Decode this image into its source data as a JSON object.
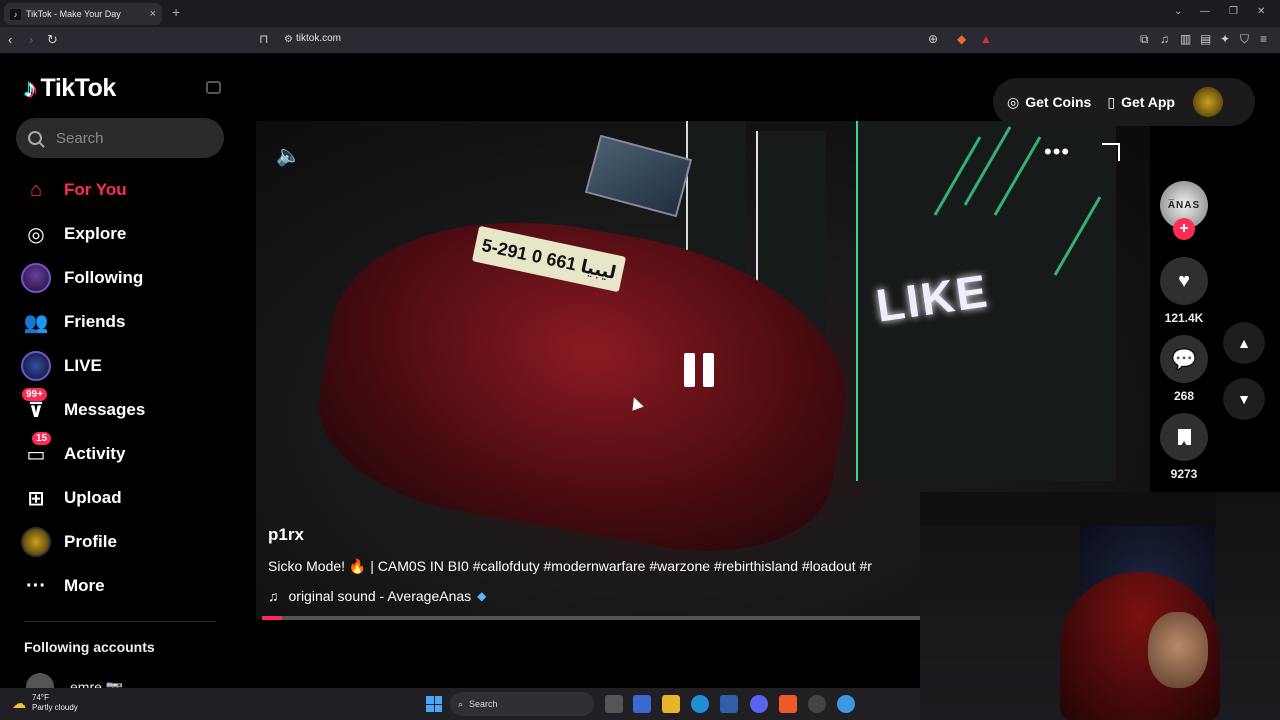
{
  "browser": {
    "tab_title": "TikTok - Make Your Day",
    "url": "tiktok.com"
  },
  "brand": {
    "name": "TikTok"
  },
  "search": {
    "placeholder": "Search"
  },
  "sidebar": {
    "items": [
      {
        "label": "For You"
      },
      {
        "label": "Explore"
      },
      {
        "label": "Following"
      },
      {
        "label": "Friends"
      },
      {
        "label": "LIVE"
      },
      {
        "label": "Messages",
        "badge": "99+"
      },
      {
        "label": "Activity",
        "badge": "15"
      },
      {
        "label": "Upload"
      },
      {
        "label": "Profile"
      },
      {
        "label": "More"
      }
    ],
    "following_title": "Following accounts",
    "following": [
      {
        "name": "emre 📷"
      }
    ]
  },
  "header": {
    "get_coins": "Get Coins",
    "get_app": "Get App"
  },
  "video": {
    "author": "p1rx",
    "caption": "Sicko Mode! 🔥 | CAM0S IN BI0 #callofduty #modernwarfare #warzone #rebirthisland #loadout #r",
    "sound": "original sound - AverageAnas",
    "plate_text": "5-291 0 661 ليبيا",
    "sign_text": "LIKE",
    "progress": 0.03
  },
  "actions": {
    "avatar_text": "A̅NAS",
    "likes": "121.4K",
    "comments": "268",
    "saves": "9273"
  },
  "taskbar": {
    "temp": "74°F",
    "condition": "Partly cloudy",
    "search_label": "Search"
  },
  "colors": {
    "accent": "#fe2c55",
    "bg": "#000000"
  }
}
